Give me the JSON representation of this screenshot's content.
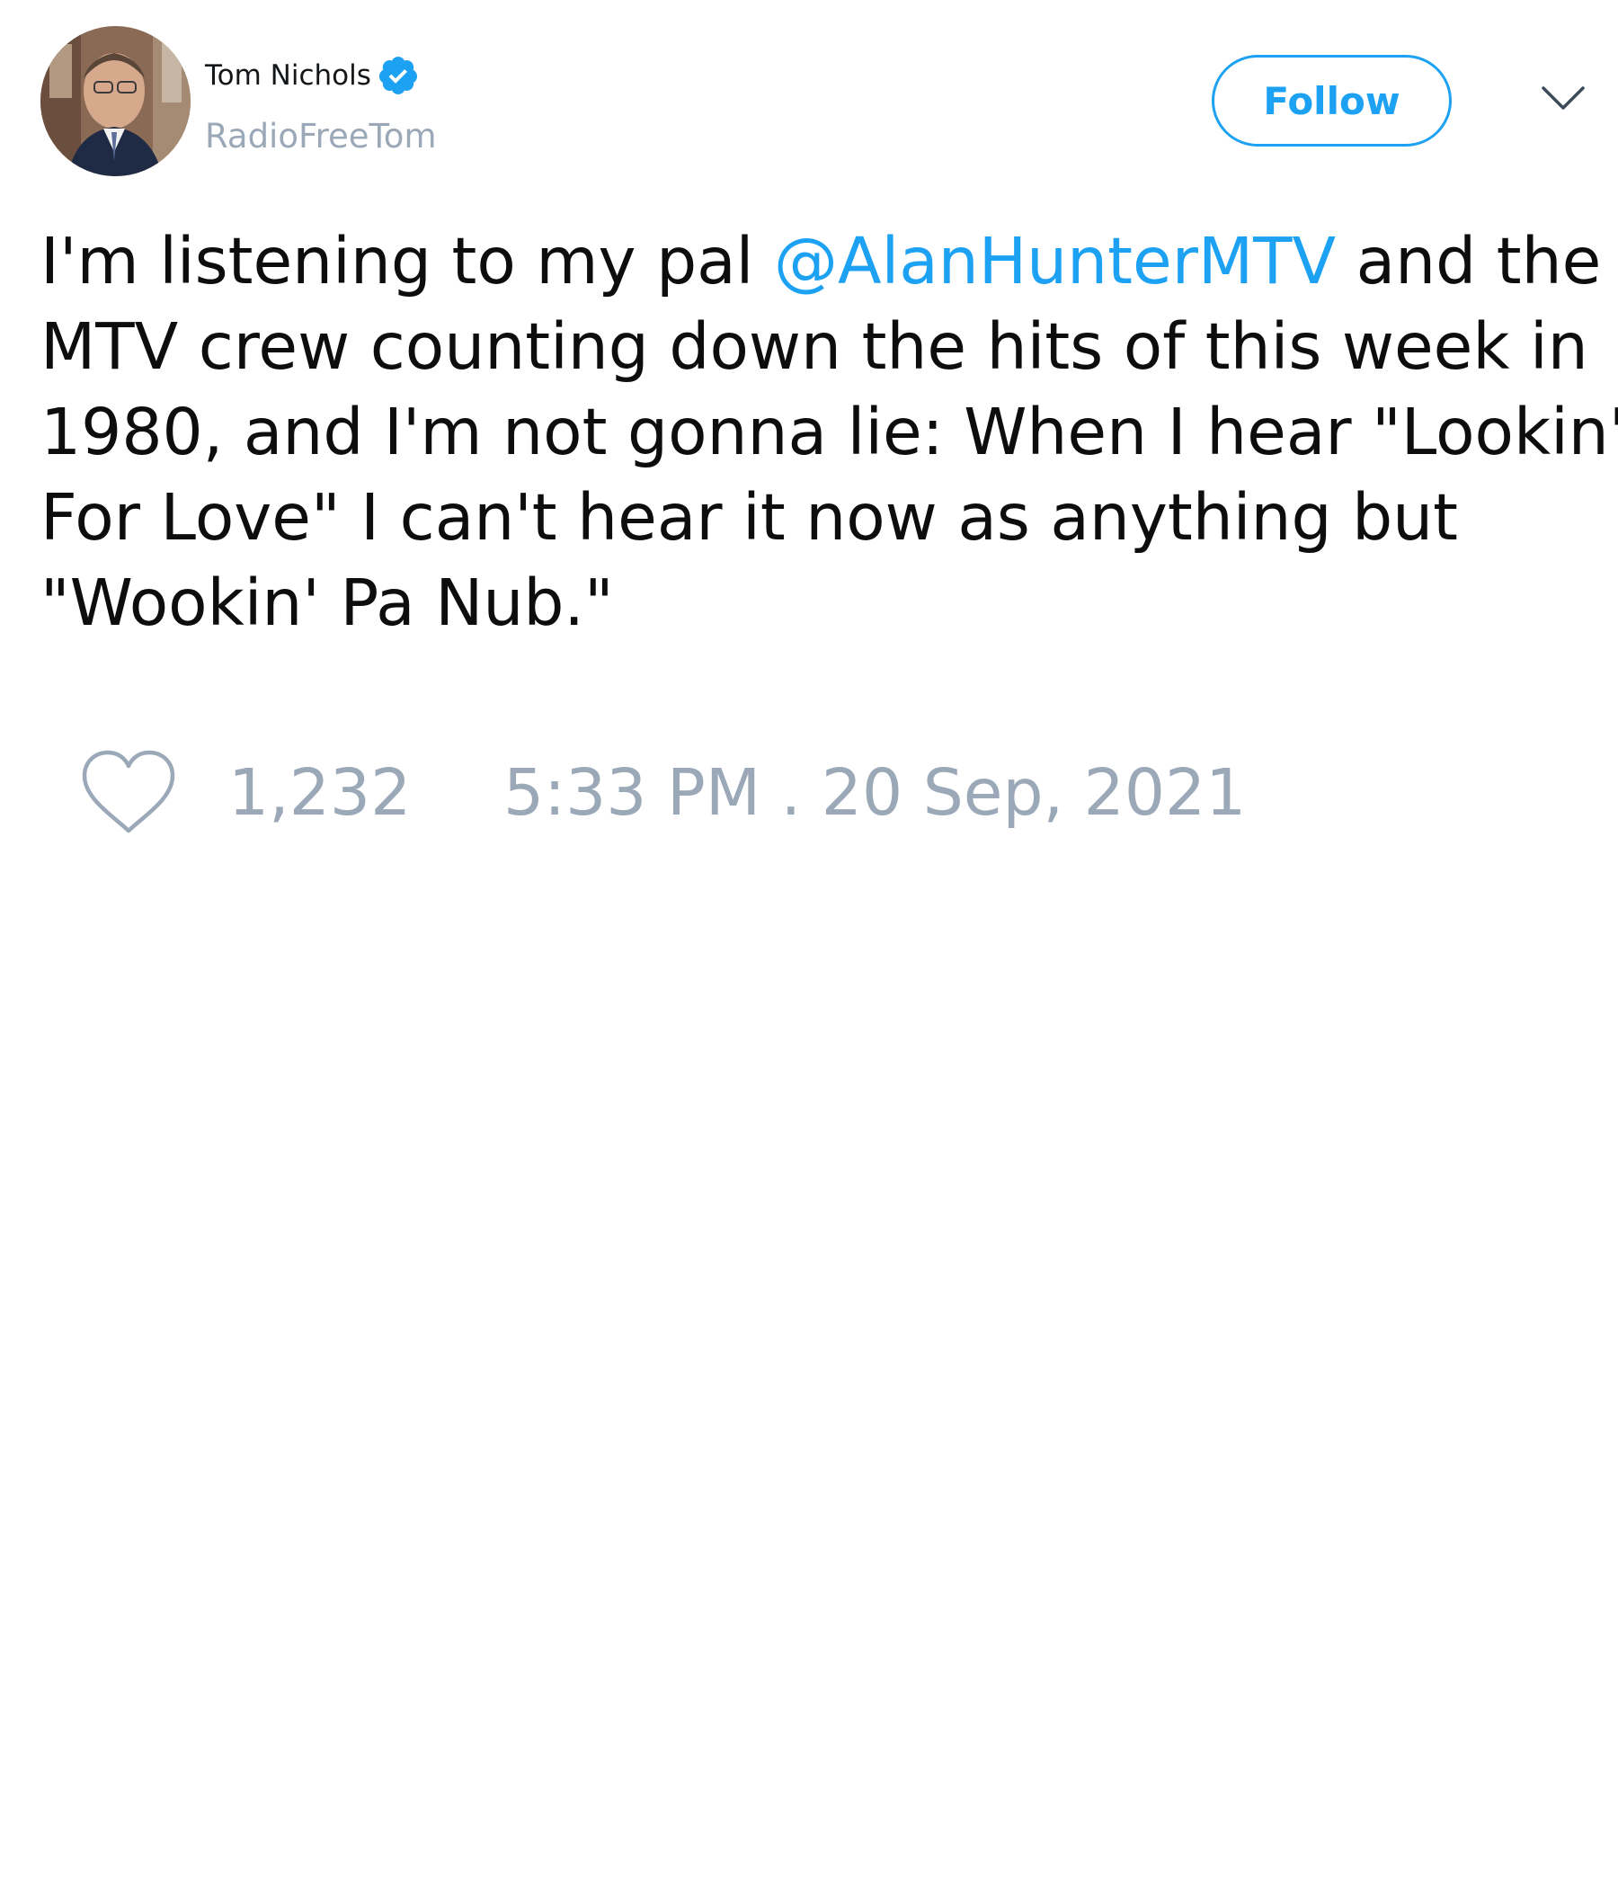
{
  "author": {
    "display_name": "Tom Nichols",
    "handle": "RadioFreeTom",
    "verified": true,
    "avatar_icon": "profile-photo"
  },
  "actions": {
    "follow_label": "Follow",
    "more_icon": "chevron-down-icon"
  },
  "tweet": {
    "text_before_mention": "I'm listening to my pal ",
    "mention": "@AlanHunterMTV",
    "text_after_mention": " and the\nMTV crew counting down the hits of this week in\n1980, and I'm not gonna lie: When I hear \"Lookin'\nFor Love\" I can't hear it now as anything but\n\"Wookin' Pa Nub.\""
  },
  "footer": {
    "like_icon": "heart-outline-icon",
    "like_count": "1,232",
    "timestamp": "5:33 PM . 20 Sep, 2021"
  },
  "colors": {
    "accent": "#1da1f2",
    "muted": "#9aa8b8",
    "text": "#0d0d0d"
  }
}
